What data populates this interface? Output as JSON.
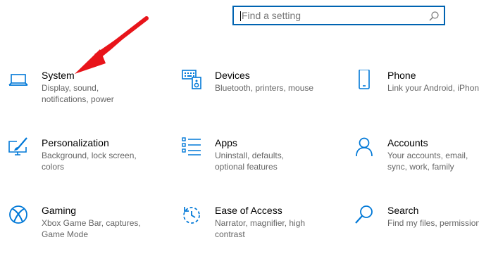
{
  "search": {
    "placeholder": "Find a setting"
  },
  "tiles": [
    {
      "title": "System",
      "desc": "Display, sound, notifications, power",
      "icon": "laptop-icon"
    },
    {
      "title": "Devices",
      "desc": "Bluetooth, printers, mouse",
      "icon": "devices-icon"
    },
    {
      "title": "Phone",
      "desc": "Link your Android, iPhone",
      "icon": "phone-icon"
    },
    {
      "title": "Personalization",
      "desc": "Background, lock screen, colors",
      "icon": "personalization-icon"
    },
    {
      "title": "Apps",
      "desc": "Uninstall, defaults, optional features",
      "icon": "apps-icon"
    },
    {
      "title": "Accounts",
      "desc": "Your accounts, email, sync, work, family",
      "icon": "accounts-icon"
    },
    {
      "title": "Gaming",
      "desc": "Xbox Game Bar, captures, Game Mode",
      "icon": "xbox-icon"
    },
    {
      "title": "Ease of Access",
      "desc": "Narrator, magnifier, high contrast",
      "icon": "ease-of-access-icon"
    },
    {
      "title": "Search",
      "desc": "Find my files, permissions",
      "icon": "search-icon"
    }
  ],
  "colors": {
    "accent": "#0063b1",
    "icon": "#0078d7",
    "arrow": "#e8141a",
    "description": "#666666"
  }
}
